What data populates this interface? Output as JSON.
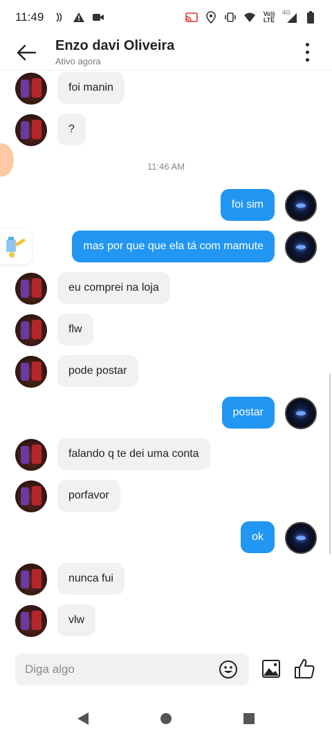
{
  "status_bar": {
    "time": "11:49",
    "network_label_top": "Vo))",
    "network_label_bottom": "LTE",
    "signal_label": "4G"
  },
  "header": {
    "contact_name": "Enzo davi Oliveira",
    "contact_status": "Ativo agora"
  },
  "thread": {
    "messages": [
      {
        "side": "in",
        "text": "foi manin"
      },
      {
        "side": "in",
        "text": "?"
      },
      {
        "side": "in",
        "text": "eu comprei na loja"
      },
      {
        "side": "in",
        "text": "flw"
      },
      {
        "side": "in",
        "text": "pode postar"
      },
      {
        "side": "in",
        "text": "falando q te dei uma conta"
      },
      {
        "side": "in",
        "text": "porfavor"
      },
      {
        "side": "in",
        "text": "nunca fui"
      },
      {
        "side": "in",
        "text": "vlw"
      },
      {
        "side": "out",
        "text": "foi sim"
      },
      {
        "side": "out",
        "text": "mas por que que ela tá com mamute"
      },
      {
        "side": "out",
        "text": "postar"
      },
      {
        "side": "out",
        "text": "ok"
      }
    ],
    "time_separator": "11:46 AM"
  },
  "composer": {
    "placeholder": "Diga algo"
  },
  "colors": {
    "accent": "#2196f3",
    "incoming_bubble": "#f1f1f3"
  }
}
